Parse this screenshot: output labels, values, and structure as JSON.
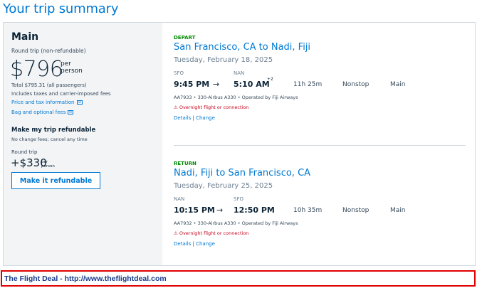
{
  "page_title": "Your trip summary",
  "summary": {
    "plan_name": "Main",
    "plan_sub": "Round trip (non-refundable)",
    "price": "$796",
    "per_person": "per person",
    "total": "Total $795.31 (all passengers)",
    "taxes": "Includes taxes and carrier-imposed fees",
    "price_link": "Price and tax information",
    "bag_link": "Bag and optional fees",
    "refund_title": "Make my trip refundable",
    "refund_sub": "No change fees; cancel any time",
    "round_trip": "Round trip",
    "refund_price": "+$330",
    "refund_per": "per person",
    "refund_button": "Make it refundable"
  },
  "depart": {
    "label": "DEPART",
    "route": "San Francisco, CA to Nadi, Fiji",
    "date": "Tuesday, February 18, 2025",
    "from_code": "SFO",
    "to_code": "NAN",
    "dep_time": "9:45 PM",
    "arrow": "→",
    "arr_time": "5:10 AM",
    "day_offset": "+2",
    "duration": "11h 25m",
    "stops": "Nonstop",
    "cabin": "Main",
    "flight_info": "AA7933 • 330-Airbus A330 • Operated by Fiji Airways",
    "overnight": "Overnight flight or connection",
    "details": "Details",
    "sep": "|",
    "change": "Change"
  },
  "return": {
    "label": "RETURN",
    "route": "Nadi, Fiji to San Francisco, CA",
    "date": "Tuesday, February 25, 2025",
    "from_code": "NAN",
    "to_code": "SFO",
    "dep_time": "10:15 PM",
    "arrow": "→",
    "arr_time": "12:50 PM",
    "duration": "10h 35m",
    "stops": "Nonstop",
    "cabin": "Main",
    "flight_info": "AA7932 • 330-Airbus A330 • Operated by Fiji Airways",
    "overnight": "Overnight flight or connection",
    "details": "Details",
    "sep": "|",
    "change": "Change"
  },
  "footer": {
    "deal_text": "The Flight Deal - http://www.theflightdeal.com"
  },
  "colors": {
    "accent": "#0078d2",
    "depart_green": "#008a00",
    "warning_red": "#c30019",
    "frame_red": "#e00000"
  }
}
